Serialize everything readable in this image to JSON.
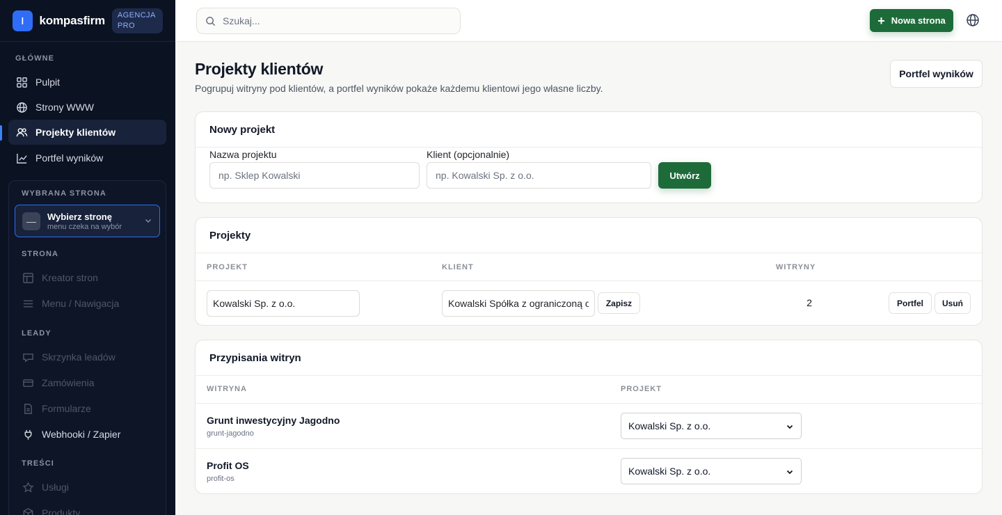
{
  "brand": {
    "name": "kompasfirm",
    "badge": "AGENCJA PRO",
    "logo_glyph": "ǀ"
  },
  "sidebar": {
    "section_main": "GŁÓWNE",
    "main_items": [
      {
        "label": "Pulpit",
        "icon": "grid-icon"
      },
      {
        "label": "Strony WWW",
        "icon": "globe-icon"
      },
      {
        "label": "Projekty klientów",
        "icon": "users-icon",
        "active": true
      },
      {
        "label": "Portfel wyników",
        "icon": "chart-line-icon"
      }
    ],
    "selected_site_label": "WYBRANA STRONA",
    "picker": {
      "title": "Wybierz stronę",
      "subtitle": "menu czeka na wybór",
      "avatar": "—"
    },
    "section_site": "STRONA",
    "site_items": [
      {
        "label": "Kreator stron",
        "icon": "layout-icon"
      },
      {
        "label": "Menu / Nawigacja",
        "icon": "menu-icon"
      }
    ],
    "section_leads": "LEADY",
    "lead_items": [
      {
        "label": "Skrzynka leadów",
        "icon": "inbox-icon"
      },
      {
        "label": "Zamówienia",
        "icon": "card-icon"
      },
      {
        "label": "Formularze",
        "icon": "form-icon"
      },
      {
        "label": "Webhooki / Zapier",
        "icon": "plug-icon"
      }
    ],
    "section_content": "TREŚCI",
    "content_items": [
      {
        "label": "Usługi",
        "icon": "star-icon"
      },
      {
        "label": "Produkty",
        "icon": "box-icon"
      }
    ]
  },
  "topbar": {
    "search_placeholder": "Szukaj...",
    "new_button": "Nowa strona"
  },
  "page": {
    "title": "Projekty klientów",
    "subtitle": "Pogrupuj witryny pod klientów, a portfel wyników pokaże każdemu klientowi jego własne liczby.",
    "portfolio_button": "Portfel wyników"
  },
  "new_project": {
    "heading": "Nowy projekt",
    "name_label": "Nazwa projektu",
    "name_placeholder": "np. Sklep Kowalski",
    "client_label": "Klient (opcjonalnie)",
    "client_placeholder": "np. Kowalski Sp. z o.o.",
    "create_button": "Utwórz"
  },
  "projects": {
    "heading": "Projekty",
    "columns": [
      "PROJEKT",
      "KLIENT",
      "WITRYNY"
    ],
    "rows": [
      {
        "name": "Kowalski Sp. z o.o.",
        "client": "Kowalski Spółka z ograniczoną odpowiedzialnością",
        "save": "Zapisz",
        "sites": "2",
        "portfolio": "Portfel",
        "delete": "Usuń"
      }
    ]
  },
  "assignments": {
    "heading": "Przypisania witryn",
    "columns": [
      "WITRYNA",
      "PROJEKT"
    ],
    "rows": [
      {
        "name": "Grunt inwestycyjny Jagodno",
        "slug": "grunt-jagodno",
        "project": "Kowalski Sp. z o.o."
      },
      {
        "name": "Profit OS",
        "slug": "profit-os",
        "project": "Kowalski Sp. z o.o."
      }
    ]
  },
  "colors": {
    "accent_green": "#1e6b3a",
    "sidebar_bg": "#0b1222",
    "brand_blue": "#2f6df6"
  }
}
